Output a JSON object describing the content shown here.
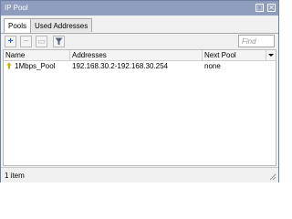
{
  "window": {
    "title": "IP Pool",
    "minimize_glyph": "□",
    "close_glyph": "✕"
  },
  "tabs": [
    {
      "label": "Pools",
      "active": true
    },
    {
      "label": "Used Addresses",
      "active": false
    }
  ],
  "toolbar": {
    "add_icon": "+",
    "remove_icon": "−",
    "copy_icon": "▭",
    "filter_icon": "funnel-icon"
  },
  "search": {
    "placeholder": "Find"
  },
  "table": {
    "columns": [
      "Name",
      "Addresses",
      "Next Pool"
    ],
    "rows": [
      {
        "name": "1Mbps_Pool",
        "addresses": "192.168.30.2-192.168.30.254",
        "next_pool": "none"
      }
    ]
  },
  "status": {
    "count": "1 item"
  },
  "colors": {
    "titlebar": "#8f9dbf",
    "accent_add": "#1f5fcf",
    "pool_icon": "#c7b300"
  }
}
